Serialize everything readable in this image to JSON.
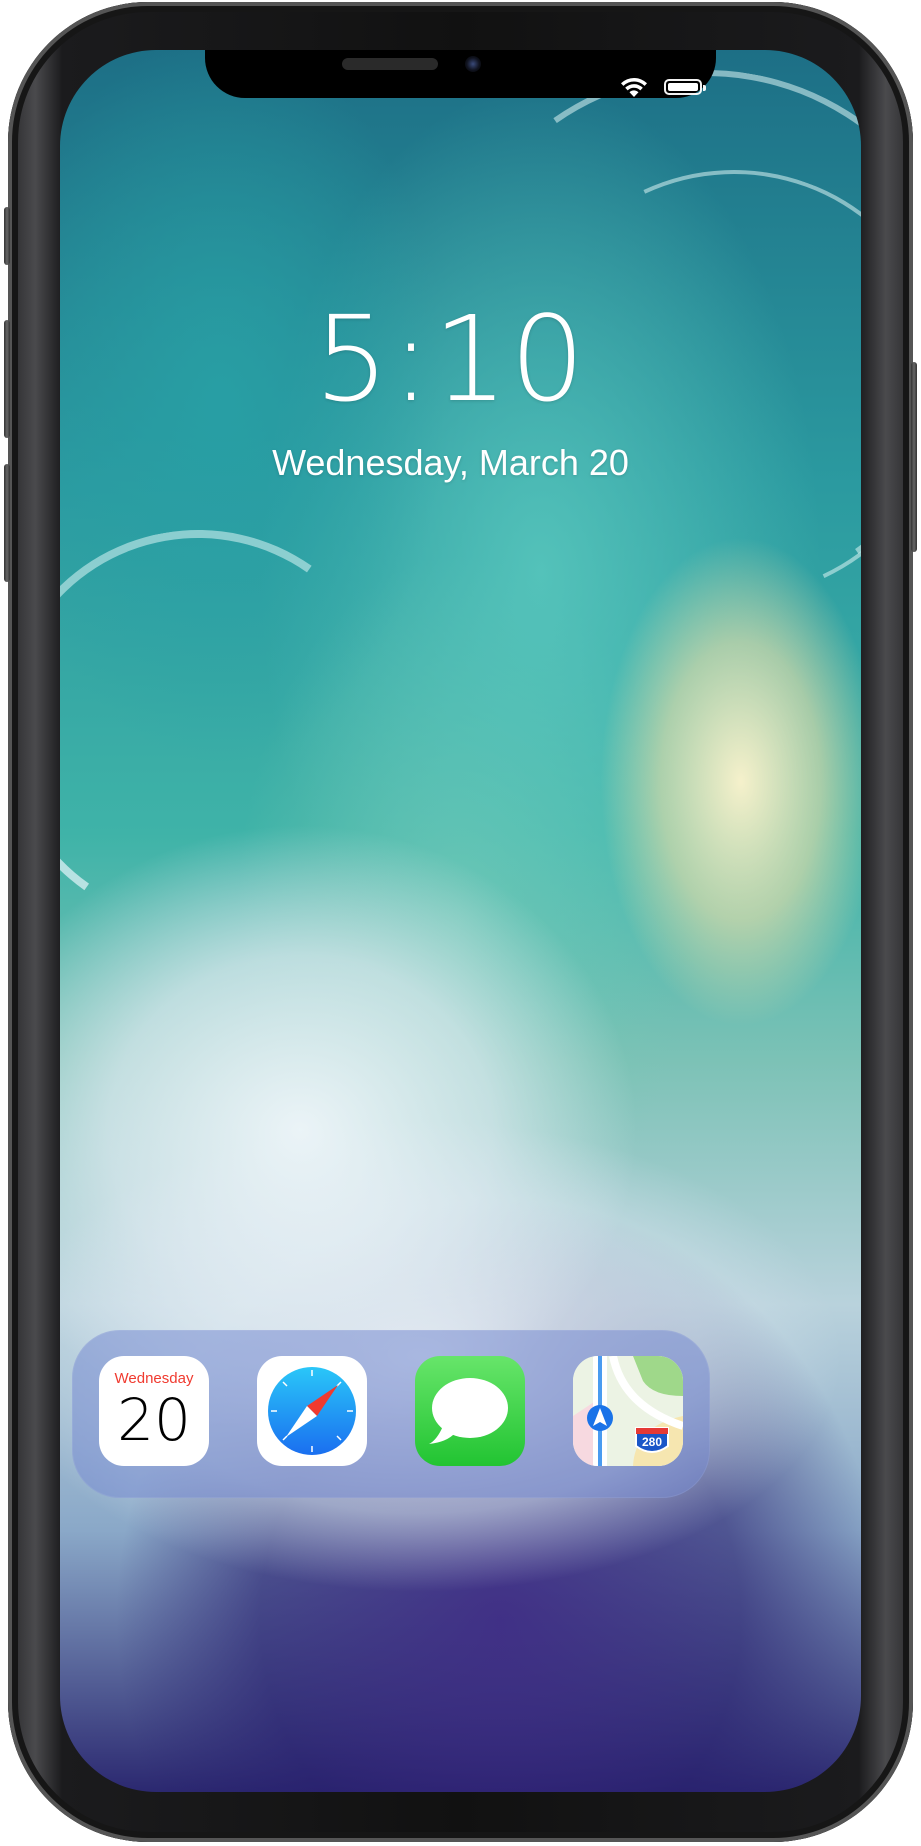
{
  "status_bar": {
    "wifi_icon": "wifi-icon",
    "battery_icon": "battery-icon",
    "battery_level": 1.0
  },
  "lock_screen": {
    "time": "5:10",
    "date": "Wednesday, March 20"
  },
  "dock": {
    "apps": [
      {
        "name": "Calendar",
        "icon": "calendar-icon",
        "day_label": "Wednesday",
        "day_number": "20"
      },
      {
        "name": "Safari",
        "icon": "safari-compass-icon"
      },
      {
        "name": "Messages",
        "icon": "speech-bubble-icon"
      },
      {
        "name": "Maps",
        "icon": "maps-icon",
        "shield_text": "280"
      }
    ]
  },
  "colors": {
    "calendar_red": "#f03a2f",
    "messages_green": "#22c432",
    "safari_blue": "#1a8cf0",
    "dock_tint": "#788cd2"
  }
}
